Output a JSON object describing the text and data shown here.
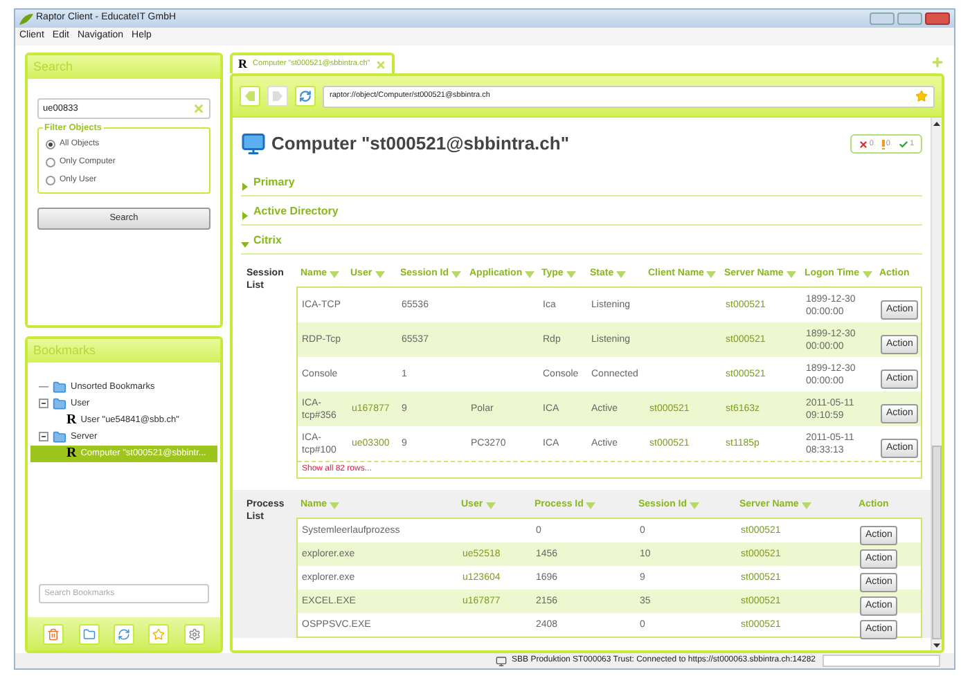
{
  "window": {
    "title": "Raptor Client - EducateIT GmbH"
  },
  "menu": [
    "Client",
    "Edit",
    "Navigation",
    "Help"
  ],
  "search_panel": {
    "title": "Search",
    "query": "ue00833",
    "filter_title": "Filter Objects",
    "filters": [
      {
        "label": "All Objects",
        "selected": true
      },
      {
        "label": "Only Computer",
        "selected": false
      },
      {
        "label": "Only User",
        "selected": false
      }
    ],
    "button": "Search"
  },
  "bookmarks": {
    "title": "Bookmarks",
    "tree": [
      {
        "label": "Unsorted Bookmarks",
        "kind": "folder",
        "selected": false,
        "expanded": false
      },
      {
        "label": "User",
        "kind": "folder",
        "selected": false,
        "expanded": true,
        "children": [
          {
            "label": "User \"ue54841@sbb.ch\"",
            "kind": "object",
            "glyph": "R",
            "selected": false
          }
        ]
      },
      {
        "label": "Server",
        "kind": "folder",
        "selected": false,
        "expanded": true,
        "children": [
          {
            "label": "Computer \"st000521@sbbintr...",
            "kind": "object",
            "glyph": "R",
            "selected": true
          }
        ]
      }
    ],
    "search_placeholder": "Search Bookmarks"
  },
  "tabs": [
    {
      "glyph": "R",
      "label": "Computer \"st000521@sbbintra.ch\"",
      "selected": true
    }
  ],
  "toolbar": {
    "back_disabled": false,
    "forward_disabled": true,
    "address": "raptor://object/Computer/st000521@sbbintra.ch"
  },
  "page": {
    "title": "Computer \"st000521@sbbintra.ch\"",
    "status": {
      "errors": "0",
      "warnings": "0",
      "ok": "1"
    },
    "sections": [
      {
        "label": "Primary",
        "expanded": false
      },
      {
        "label": "Active Directory",
        "expanded": false
      },
      {
        "label": "Citrix",
        "expanded": true
      }
    ]
  },
  "session_list": {
    "label": "Session List",
    "columns": [
      {
        "label": "Name",
        "sortable": true
      },
      {
        "label": "User",
        "sortable": true
      },
      {
        "label": "Session Id",
        "sortable": true
      },
      {
        "label": "Application",
        "sortable": true
      },
      {
        "label": "Type",
        "sortable": true
      },
      {
        "label": "State",
        "sortable": true
      },
      {
        "label": "Client Name",
        "sortable": true
      },
      {
        "label": "Server Name",
        "sortable": true
      },
      {
        "label": "Logon Time",
        "sortable": true
      },
      {
        "label": "Action",
        "sortable": false
      }
    ],
    "rows": [
      {
        "cells": [
          {
            "text": "ICA-TCP"
          },
          null,
          {
            "text": "65536"
          },
          null,
          {
            "text": "Ica"
          },
          {
            "text": "Listening"
          },
          null,
          {
            "text": "st000521",
            "link": true
          },
          {
            "text": "1899-12-30 00:00:00"
          }
        ],
        "action": "Action"
      },
      {
        "cells": [
          {
            "text": "RDP-Tcp"
          },
          null,
          {
            "text": "65537"
          },
          null,
          {
            "text": "Rdp"
          },
          {
            "text": "Listening"
          },
          null,
          {
            "text": "st000521",
            "link": true
          },
          {
            "text": "1899-12-30 00:00:00"
          }
        ],
        "action": "Action"
      },
      {
        "cells": [
          {
            "text": "Console"
          },
          null,
          {
            "text": "1"
          },
          null,
          {
            "text": "Console"
          },
          {
            "text": "Connected"
          },
          null,
          {
            "text": "st000521",
            "link": true
          },
          {
            "text": "1899-12-30 00:00:00"
          }
        ],
        "action": "Action"
      },
      {
        "cells": [
          {
            "text": "ICA-tcp#356"
          },
          {
            "text": "u167877",
            "link": true
          },
          {
            "text": "9"
          },
          {
            "text": "Polar"
          },
          {
            "text": "ICA"
          },
          {
            "text": "Active"
          },
          {
            "text": "st000521",
            "link": true
          },
          {
            "text": "st6163z",
            "link": true
          },
          {
            "text": "2011-05-11 09:10:59"
          }
        ],
        "action": "Action"
      },
      {
        "cells": [
          {
            "text": "ICA-tcp#100"
          },
          {
            "text": "ue03300",
            "link": true
          },
          {
            "text": "9"
          },
          {
            "text": "PC3270"
          },
          {
            "text": "ICA"
          },
          {
            "text": "Active"
          },
          {
            "text": "st000521",
            "link": true
          },
          {
            "text": "st1185p",
            "link": true
          },
          {
            "text": "2011-05-11 08:33:13"
          }
        ],
        "action": "Action"
      }
    ],
    "show_all": "Show all 82 rows..."
  },
  "process_list": {
    "label": "Process List",
    "columns": [
      {
        "label": "Name",
        "sortable": true
      },
      {
        "label": "User",
        "sortable": true
      },
      {
        "label": "Process Id",
        "sortable": true
      },
      {
        "label": "Session Id",
        "sortable": true
      },
      {
        "label": "Server Name",
        "sortable": true
      },
      {
        "label": "Action",
        "sortable": false
      }
    ],
    "rows": [
      {
        "cells": [
          {
            "text": "Systemleerlaufprozess"
          },
          null,
          {
            "text": "0"
          },
          {
            "text": "0"
          },
          {
            "text": "st000521",
            "link": true
          }
        ],
        "action": "Action"
      },
      {
        "cells": [
          {
            "text": "explorer.exe"
          },
          {
            "text": "ue52518",
            "link": true
          },
          {
            "text": "1456"
          },
          {
            "text": "10"
          },
          {
            "text": "st000521",
            "link": true
          }
        ],
        "action": "Action"
      },
      {
        "cells": [
          {
            "text": "explorer.exe"
          },
          {
            "text": "u123604",
            "link": true
          },
          {
            "text": "1696"
          },
          {
            "text": "9"
          },
          {
            "text": "st000521",
            "link": true
          }
        ],
        "action": "Action"
      },
      {
        "cells": [
          {
            "text": "EXCEL.EXE"
          },
          {
            "text": "u167877",
            "link": true
          },
          {
            "text": "2156"
          },
          {
            "text": "35"
          },
          {
            "text": "st000521",
            "link": true
          }
        ],
        "action": "Action"
      },
      {
        "cells": [
          {
            "text": "OSPPSVC.EXE"
          },
          null,
          {
            "text": "2408"
          },
          {
            "text": "0"
          },
          {
            "text": "st000521",
            "link": true
          }
        ],
        "action": "Action"
      }
    ]
  },
  "status_bar": {
    "text": "SBB Produktion ST000063 Trust: Connected to https://st000063.sbbintra.ch:14282"
  }
}
